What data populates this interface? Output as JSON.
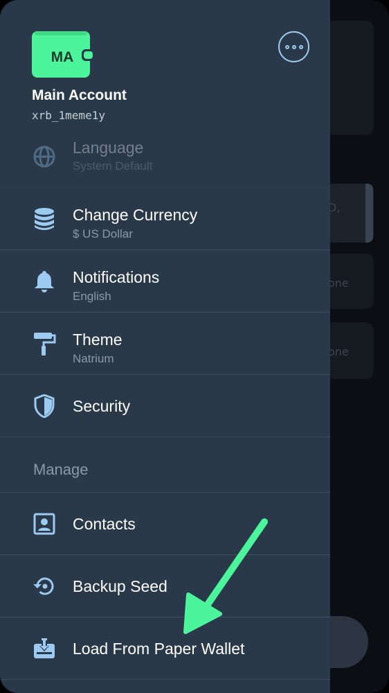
{
  "account": {
    "initials": "MA",
    "name": "Main Account",
    "address": "xrb_1meme1y"
  },
  "settings": [
    {
      "title": "Language",
      "subtitle": "System Default",
      "icon": "globe-icon"
    },
    {
      "title": "Change Currency",
      "subtitle": "$ US Dollar",
      "icon": "coins-stack-icon"
    },
    {
      "title": "Notifications",
      "subtitle": "English",
      "icon": "bell-icon"
    },
    {
      "title": "Theme",
      "subtitle": "Natrium",
      "icon": "paint-roller-icon"
    },
    {
      "title": "Security",
      "icon": "shield-icon"
    }
  ],
  "manage": {
    "header": "Manage",
    "items": [
      {
        "title": "Contacts",
        "icon": "contact-card-icon"
      },
      {
        "title": "Backup Seed",
        "icon": "backup-restore-icon"
      },
      {
        "title": "Load From Paper Wallet",
        "icon": "paper-wallet-import-icon"
      }
    ]
  },
  "background": {
    "text_1": "D,",
    "text_2": "one",
    "text_3": "one"
  },
  "colors": {
    "drawer": "#2a394a",
    "accent_green": "#4cf59b",
    "icon_blue": "#9ccaf0",
    "divider": "#3d4d5e"
  }
}
